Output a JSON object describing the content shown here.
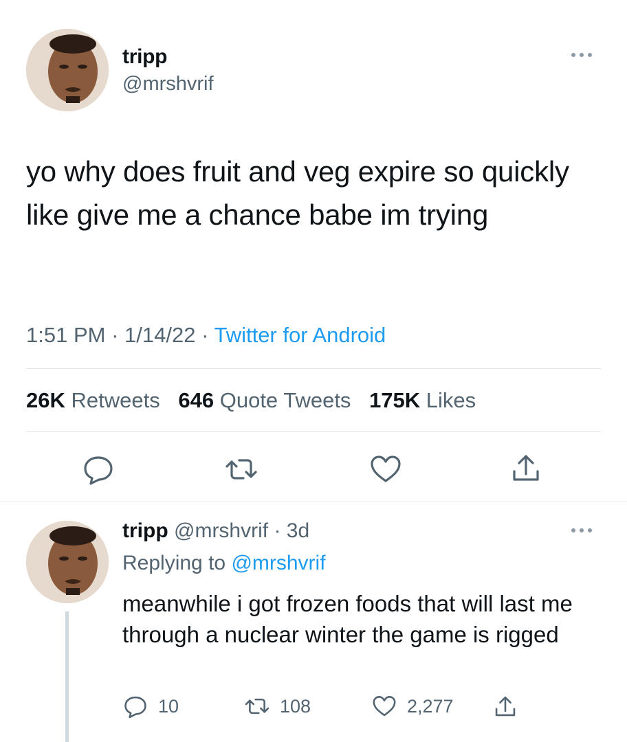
{
  "main_tweet": {
    "author_name": "tripp",
    "author_handle": "@mrshvrif",
    "text": "yo why does fruit and veg expire so quickly like give me a chance babe im trying",
    "time": "1:51 PM",
    "date": "1/14/22",
    "source": "Twitter for Android",
    "stats": {
      "retweets_count": "26K",
      "retweets_label": "Retweets",
      "quotes_count": "646",
      "quotes_label": "Quote Tweets",
      "likes_count": "175K",
      "likes_label": "Likes"
    },
    "icons": [
      "more-icon",
      "reply-icon",
      "retweet-icon",
      "like-icon",
      "share-icon"
    ]
  },
  "reply_tweet": {
    "author_name": "tripp",
    "author_handle": "@mrshvrif",
    "age": "3d",
    "replying_prefix": "Replying to",
    "replying_to": "@mrshvrif",
    "text": "meanwhile i got frozen foods that will last me through a nuclear winter the game is rigged",
    "replies": "10",
    "retweets": "108",
    "likes": "2,277"
  },
  "colors": {
    "accent": "#1d9bf0",
    "secondary_text": "#536471",
    "primary_text": "#0f1419",
    "divider": "#e1e6ea"
  }
}
